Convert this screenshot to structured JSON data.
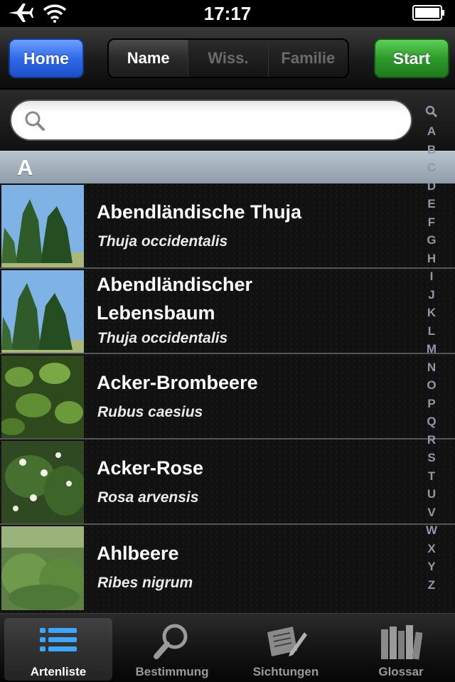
{
  "status_bar": {
    "time": "17:17",
    "icons": [
      "airplane-icon",
      "wifi-icon",
      "battery-icon"
    ]
  },
  "toolbar": {
    "home_label": "Home",
    "start_label": "Start",
    "segments": [
      {
        "label": "Name",
        "selected": true
      },
      {
        "label": "Wiss.",
        "selected": false
      },
      {
        "label": "Familie",
        "selected": false
      }
    ]
  },
  "search": {
    "value": "",
    "placeholder": ""
  },
  "section": {
    "letter": "A"
  },
  "index": [
    "A",
    "B",
    "C",
    "D",
    "E",
    "F",
    "G",
    "H",
    "I",
    "J",
    "K",
    "L",
    "M",
    "N",
    "O",
    "P",
    "Q",
    "R",
    "S",
    "T",
    "U",
    "V",
    "W",
    "X",
    "Y",
    "Z"
  ],
  "species": [
    {
      "name": "Abendländische Thuja",
      "scientific": "Thuja occidentalis"
    },
    {
      "name": "Abendländischer Lebensbaum",
      "scientific": "Thuja occidentalis"
    },
    {
      "name": "Acker-Brombeere",
      "scientific": "Rubus caesius"
    },
    {
      "name": "Acker-Rose",
      "scientific": "Rosa arvensis"
    },
    {
      "name": "Ahlbeere",
      "scientific": "Ribes nigrum"
    }
  ],
  "tabs": [
    {
      "label": "Artenliste",
      "icon": "list-icon",
      "selected": true
    },
    {
      "label": "Bestimmung",
      "icon": "magnifier-icon",
      "selected": false
    },
    {
      "label": "Sichtungen",
      "icon": "notebook-pen-icon",
      "selected": false
    },
    {
      "label": "Glossar",
      "icon": "books-icon",
      "selected": false
    }
  ],
  "colors": {
    "home_button": "#2f6ae8",
    "start_button": "#2d9a2b",
    "section_header": "#a3b0bc",
    "index_text": "#8e98a8"
  }
}
